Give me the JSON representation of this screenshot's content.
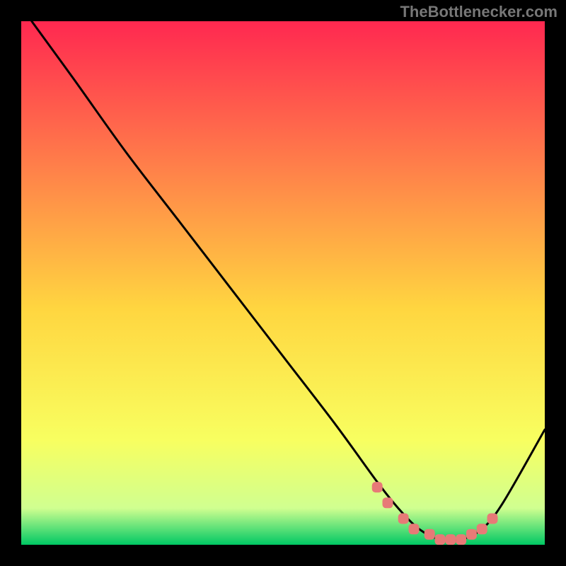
{
  "watermark": "TheBottleneсker.com",
  "chart_data": {
    "type": "line",
    "title": "",
    "xlabel": "",
    "ylabel": "",
    "xlim": [
      0,
      100
    ],
    "ylim": [
      0,
      100
    ],
    "gradient_colors": {
      "top": "#ff2850",
      "mid_high": "#ff7d4a",
      "mid": "#ffd640",
      "mid_low": "#f8ff60",
      "low": "#d0ff90",
      "bottom": "#00c864"
    },
    "series": [
      {
        "name": "bottleneck-curve",
        "color": "#000000",
        "x": [
          2,
          10,
          20,
          30,
          40,
          50,
          60,
          68,
          72,
          76,
          80,
          84,
          88,
          92,
          100
        ],
        "y": [
          100,
          89,
          75,
          62,
          49,
          36,
          23,
          12,
          7,
          3,
          1,
          1,
          3,
          8,
          22
        ]
      }
    ],
    "marker_points": {
      "name": "highlight-markers",
      "color": "#e77a77",
      "x": [
        68,
        70,
        73,
        75,
        78,
        80,
        82,
        84,
        86,
        88,
        90
      ],
      "y": [
        11,
        8,
        5,
        3,
        2,
        1,
        1,
        1,
        2,
        3,
        5
      ]
    }
  }
}
